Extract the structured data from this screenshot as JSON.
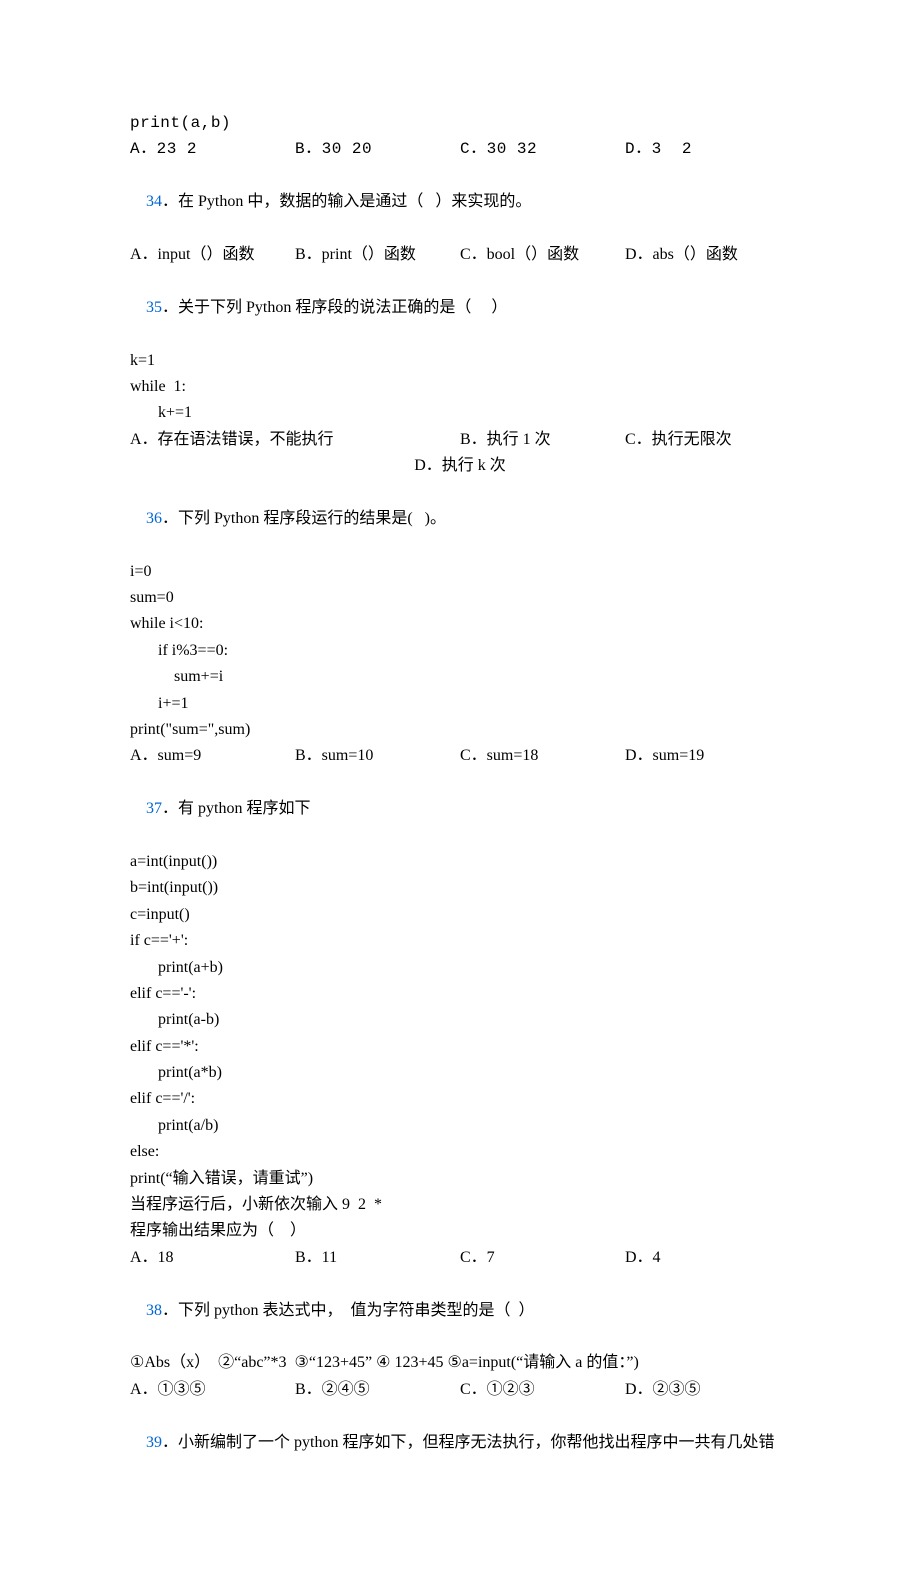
{
  "q33": {
    "code_line": "print(a,b)",
    "A": "A．23 2",
    "B": "B．30 20",
    "C": "C．30 32",
    "D": "D．3  2"
  },
  "q34": {
    "num": "34",
    "stem": "．在 Python 中，数据的输入是通过（   ）来实现的。",
    "A": "A．input（）函数",
    "B": "B．print（）函数",
    "C": "C．bool（）函数",
    "D": "D．abs（）函数"
  },
  "q35": {
    "num": "35",
    "stem": "．关于下列 Python 程序段的说法正确的是（     ）",
    "c1": "k=1",
    "c2": "while  1:",
    "c3": "k+=1",
    "A": "A．存在语法错误，不能执行",
    "B": "B．执行 1 次",
    "C": "C．执行无限次",
    "D": "D．执行 k 次"
  },
  "q36": {
    "num": "36",
    "stem": "．下列 Python 程序段运行的结果是(   )。",
    "c1": "i=0",
    "c2": "sum=0",
    "c3": "while i<10:",
    "c4": "if i%3==0:",
    "c5": "sum+=i",
    "c6": "i+=1",
    "c7": "print(\"sum=\",sum)",
    "A": "A．sum=9",
    "B": "B．sum=10",
    "C": "C．sum=18",
    "D": "D．sum=19"
  },
  "q37": {
    "num": "37",
    "stem": "．有 python 程序如下",
    "c1": "a=int(input())",
    "c2": "b=int(input())",
    "c3": "c=input()",
    "c4": "if c=='+':",
    "c5": "print(a+b)",
    "c6": "elif c=='-':",
    "c7": "print(a-b)",
    "c8": "elif c=='*':",
    "c9": "print(a*b)",
    "c10": "elif c=='/':",
    "c11": "print(a/b)",
    "c12": "else:",
    "c13": "print(“输入错误，请重试”)",
    "run1": "当程序运行后，小新依次输入 9  2  *",
    "run2": "程序输出结果应为（    ）",
    "A": "A．18",
    "B": "B．11",
    "C": "C．7",
    "D": "D．4"
  },
  "q38": {
    "num": "38",
    "stem": "．下列 python 表达式中，  值为字符串类型的是（  ）",
    "list": "①Abs（x）  ②“abc”*3  ③“123+45” ④ 123+45 ⑤a=input(“请输入 a 的值：”)",
    "A": "A．①③⑤",
    "B": "B．②④⑤",
    "C": "C．①②③",
    "D": "D．②③⑤"
  },
  "q39": {
    "num": "39",
    "stem": "．小新编制了一个 python 程序如下，但程序无法执行，你帮他找出程序中一共有几处错"
  }
}
